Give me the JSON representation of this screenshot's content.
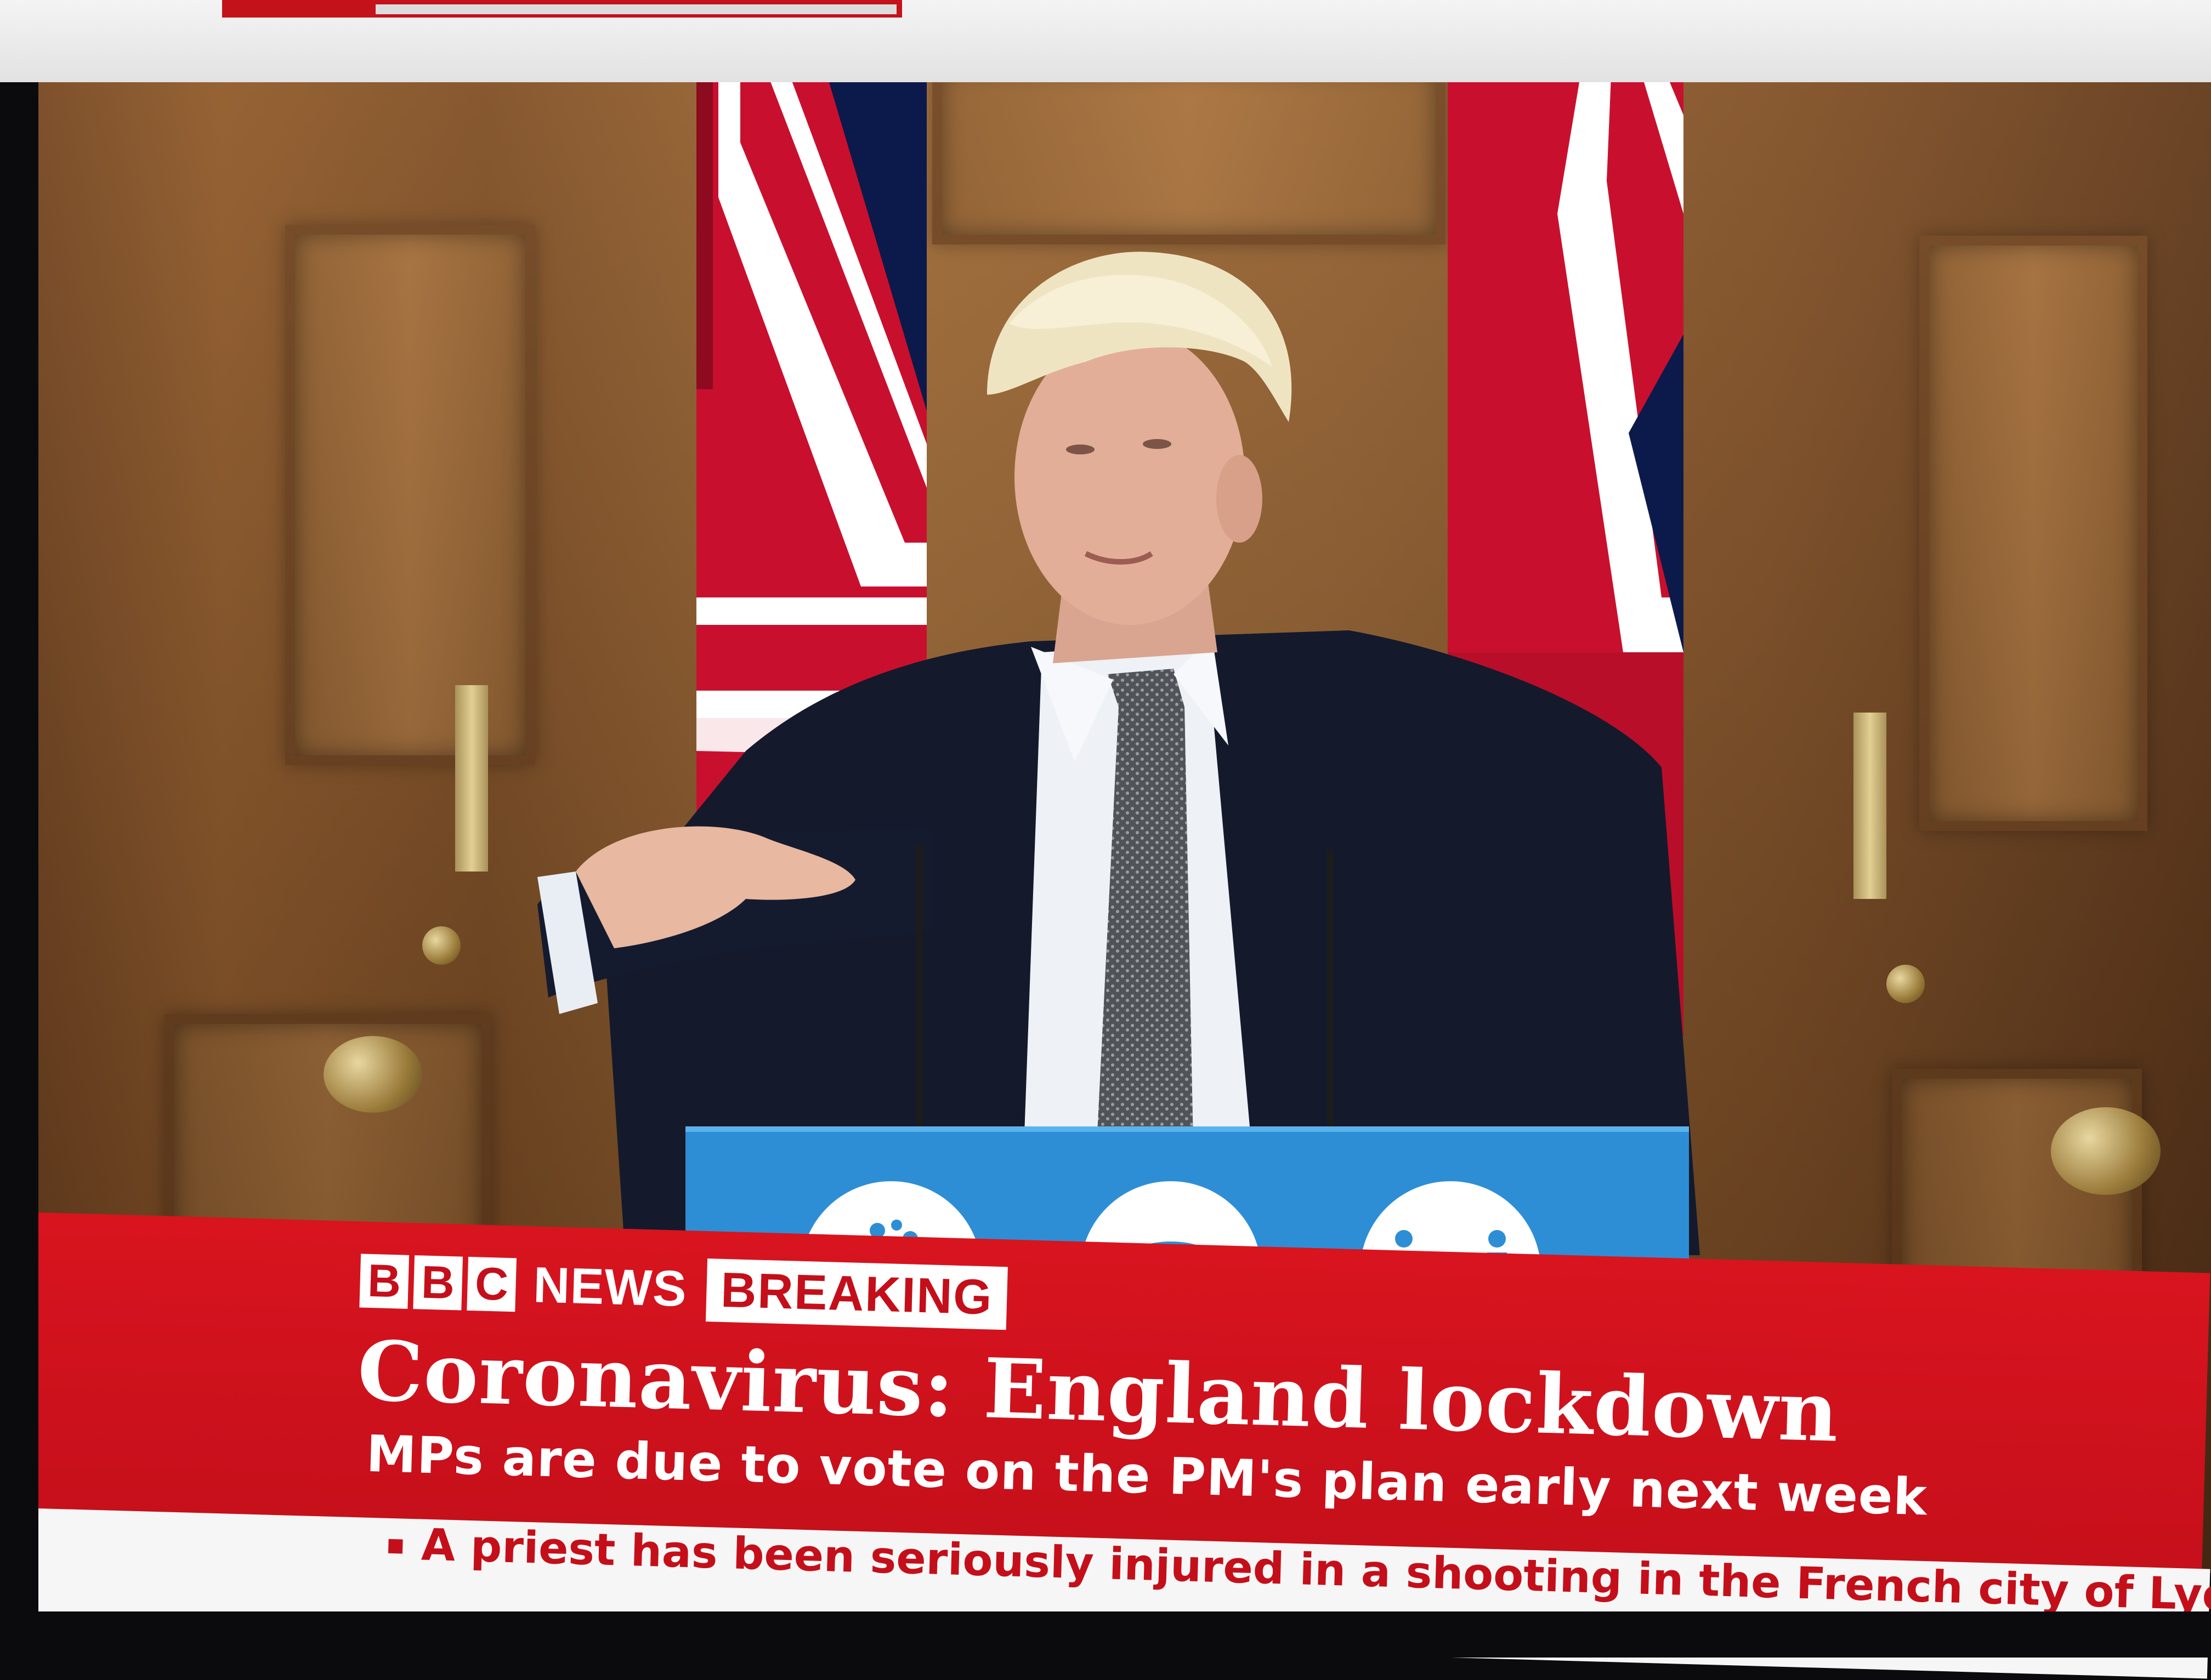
{
  "broadcaster": {
    "logo_letters": [
      "B",
      "B",
      "C"
    ],
    "channel_word": "NEWS",
    "tag": "BREAKING"
  },
  "headline": "Coronavirus: England lockdown",
  "subheadline": "MPs are due to vote on the PM's plan early next week",
  "ticker": {
    "text": "A priest has been seriously injured in a shooting in the French city of Lyon"
  },
  "lectern": {
    "signs": [
      "hand-washing-icon",
      "face-mask-icon",
      "social-distancing-icon"
    ]
  },
  "colors": {
    "bbc_red": "#c40f1a",
    "lectern_blue": "#2d8ed6",
    "wood": "#8a5527"
  }
}
